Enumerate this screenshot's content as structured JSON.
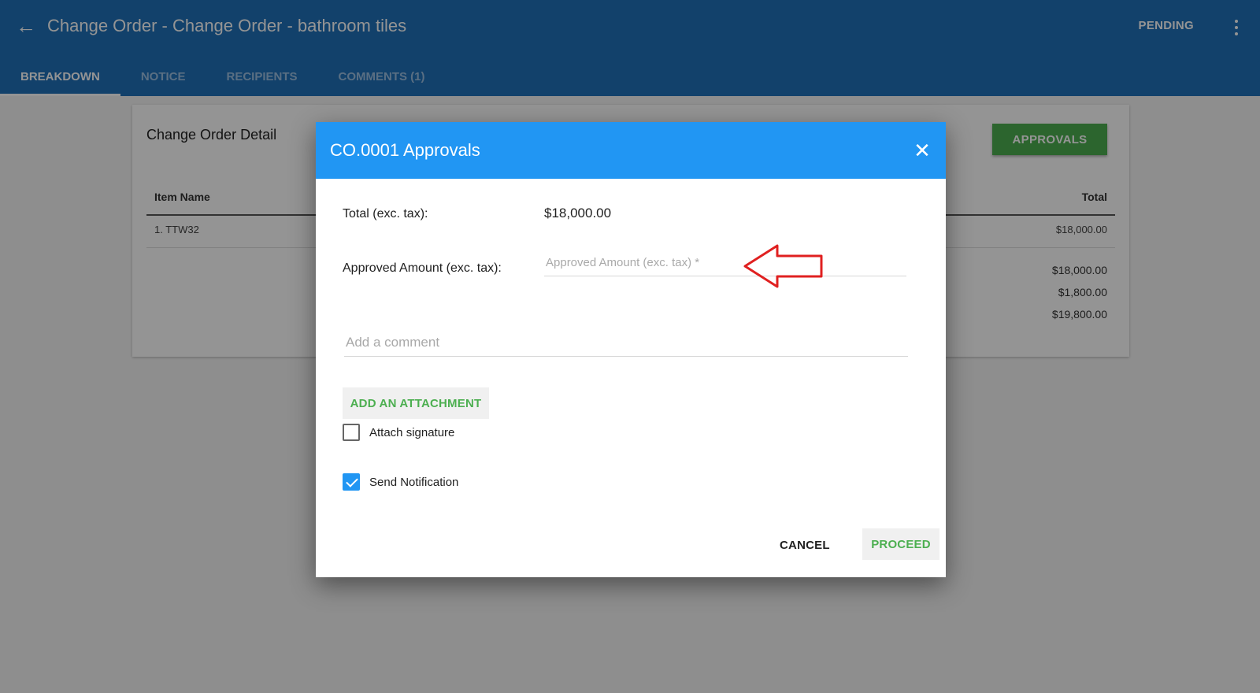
{
  "header": {
    "title": "Change Order - Change Order - bathroom tiles",
    "status": "PENDING",
    "back_icon": "arrow-left-icon",
    "menu_icon": "more-vert-icon",
    "tabs": [
      {
        "label": "BREAKDOWN",
        "active": true
      },
      {
        "label": "NOTICE",
        "active": false
      },
      {
        "label": "RECIPIENTS",
        "active": false
      },
      {
        "label": "COMMENTS (1)",
        "active": false
      }
    ]
  },
  "detail": {
    "title": "Change Order Detail",
    "approvals_button": "APPROVALS",
    "columns": {
      "item_name": "Item Name",
      "total": "Total"
    },
    "rows": [
      {
        "name": "1. TTW32",
        "total": "$18,000.00"
      }
    ],
    "summary": [
      "$18,000.00",
      "$1,800.00",
      "$19,800.00"
    ]
  },
  "dialog": {
    "title": "CO.0001 Approvals",
    "close_icon": "close-icon",
    "total_label": "Total (exc. tax):",
    "total_value": "$18,000.00",
    "approved_label": "Approved Amount (exc. tax):",
    "approved_placeholder": "Approved Amount (exc. tax) *",
    "approved_value": "",
    "comment_placeholder": "Add a comment",
    "add_attachment": "ADD AN ATTACHMENT",
    "attach_signature": {
      "label": "Attach signature",
      "checked": false
    },
    "send_notification": {
      "label": "Send Notification",
      "checked": true
    },
    "cancel": "CANCEL",
    "proceed": "PROCEED"
  },
  "colors": {
    "appbar": "#1f70b8",
    "dialog_header": "#2196f3",
    "accent_green": "#4caf50",
    "annotation_arrow": "#e02020"
  }
}
